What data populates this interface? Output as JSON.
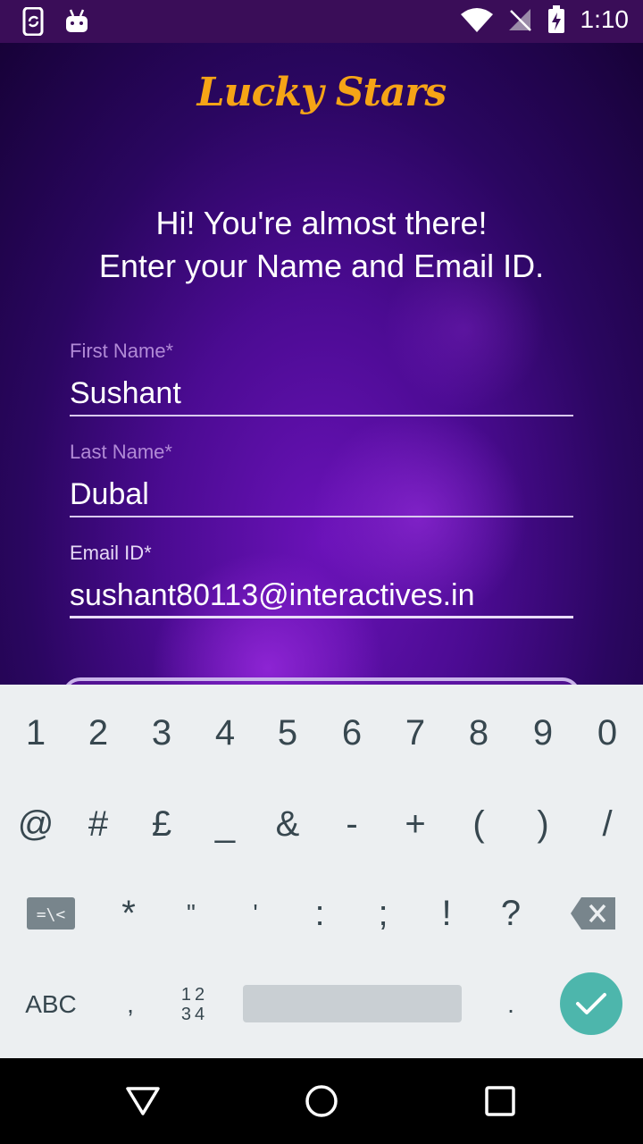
{
  "status_bar": {
    "time": "1:10",
    "icons": [
      "phone-sync-icon",
      "android-icon",
      "wifi-icon",
      "no-signal-icon",
      "battery-charging-icon"
    ]
  },
  "app": {
    "brand": "Lucky Stars",
    "greeting_line1": "Hi! You're almost there!",
    "greeting_line2": "Enter your Name and Email ID.",
    "fields": {
      "first_name": {
        "label": "First Name*",
        "value": "Sushant"
      },
      "last_name": {
        "label": "Last Name*",
        "value": "Dubal"
      },
      "email": {
        "label": "Email ID*",
        "value": "sushant80113@interactives.in"
      }
    }
  },
  "keyboard": {
    "row1": [
      "1",
      "2",
      "3",
      "4",
      "5",
      "6",
      "7",
      "8",
      "9",
      "0"
    ],
    "row2": [
      "@",
      "#",
      "£",
      "_",
      "&",
      "-",
      "+",
      "(",
      ")",
      "/"
    ],
    "row3": [
      "=\\<",
      "*",
      "\"",
      "'",
      ":",
      ";",
      "!",
      "?"
    ],
    "row4": {
      "abc": "ABC",
      "comma": ",",
      "numtoggle_top": "12",
      "numtoggle_bottom": "34",
      "period": "."
    }
  },
  "colors": {
    "brand": "#f6a416",
    "enter_key": "#4db6ac",
    "keyboard_bg": "#eceff1"
  }
}
